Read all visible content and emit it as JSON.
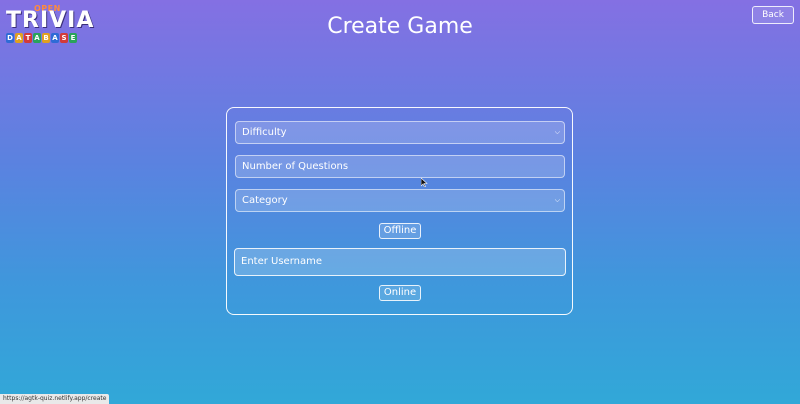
{
  "logo": {
    "top_text": "OPEN",
    "main_text": "TRIVIA",
    "db_letters": [
      "D",
      "A",
      "T",
      "A",
      "B",
      "A",
      "S",
      "E"
    ],
    "db_colors": [
      "#2e6bd6",
      "#e0a020",
      "#d23a3a",
      "#29a35a",
      "#e0a020",
      "#2e6bd6",
      "#d23a3a",
      "#29a35a"
    ]
  },
  "header": {
    "title": "Create Game",
    "back_label": "Back"
  },
  "form": {
    "difficulty": {
      "selected": "Difficulty"
    },
    "questions": {
      "placeholder": "Number of Questions"
    },
    "category": {
      "selected": "Category"
    },
    "offline_label": "Offline",
    "username": {
      "placeholder": "Enter Username"
    },
    "online_label": "Online"
  },
  "status_bar": {
    "url": "https://agtk-quiz.netlify.app/create"
  }
}
